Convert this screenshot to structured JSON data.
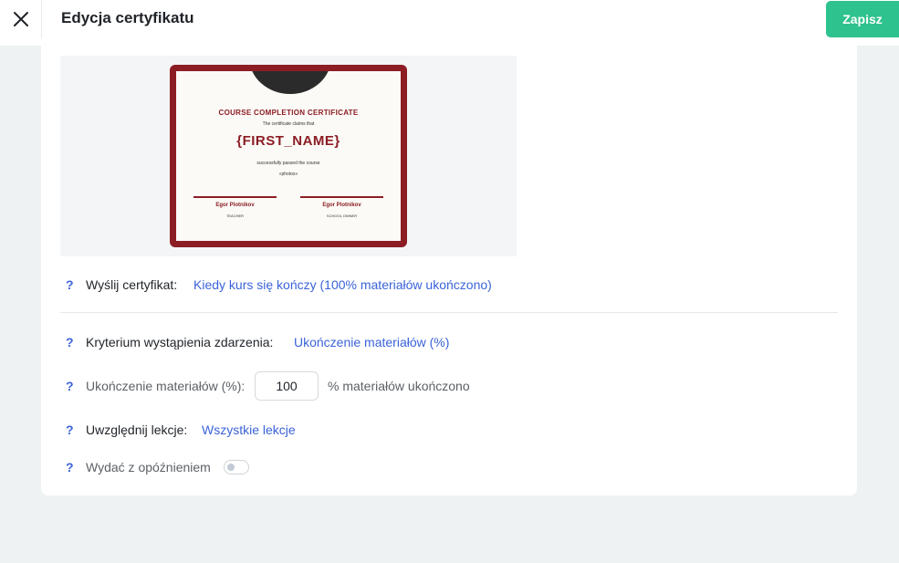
{
  "header": {
    "title": "Edycja certyfikatu",
    "save_label": "Zapisz"
  },
  "certificate": {
    "heading": "COURSE COMPLETION CERTIFICATE",
    "claims_text": "The certificate claims that",
    "name": "{FIRST_NAME}",
    "passed_text": "successfully passed the course",
    "course": "«photos»",
    "signatures": [
      {
        "name": "Egor Plotnikov",
        "role": "TEACHER"
      },
      {
        "name": "Egor Plotnikov",
        "role": "SCHOOL OWNER"
      }
    ],
    "colors": {
      "frame": "#8c1d24",
      "paper": "#fbfaf6"
    }
  },
  "settings": {
    "help_mark": "?",
    "send": {
      "label": "Wyślij certyfikat:",
      "value": "Kiedy kurs się kończy (100% materiałów ukończono)"
    },
    "criterion": {
      "label": "Kryterium wystąpienia zdarzenia:",
      "value": "Ukończenie materiałów (%)"
    },
    "completion": {
      "label": "Ukończenie materiałów (%):",
      "value": "100",
      "suffix": "% materiałów ukończono"
    },
    "lessons": {
      "label": "Uwzględnij lekcje:",
      "value": "Wszystkie lekcje"
    },
    "delay": {
      "label": "Wydać z opóźnieniem",
      "enabled": false
    }
  },
  "colors": {
    "accent": "#2ec28e",
    "link": "#3b63d9",
    "background": "#eff2f3"
  }
}
